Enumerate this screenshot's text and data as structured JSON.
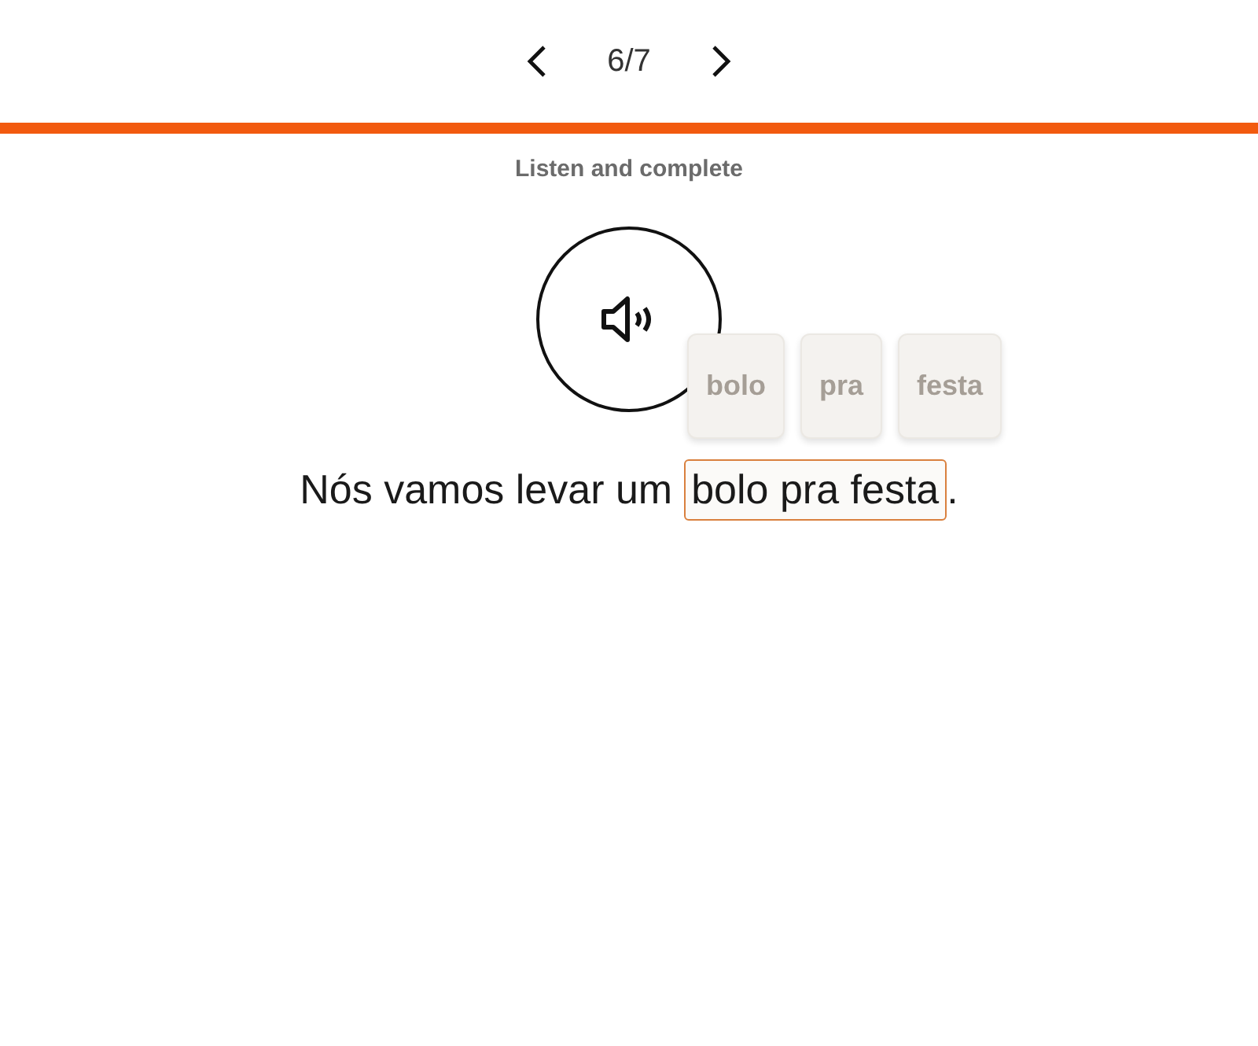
{
  "pager": {
    "counter": "6/7"
  },
  "progress": {
    "level": 1
  },
  "instruction": "Listen and complete",
  "word_tiles": [
    {
      "word": "bolo",
      "used": true
    },
    {
      "word": "pra",
      "used": true
    },
    {
      "word": "festa",
      "used": true
    }
  ],
  "sentence": {
    "before": "Nós vamos levar um",
    "answer": "bolo pra festa",
    "after": "."
  }
}
